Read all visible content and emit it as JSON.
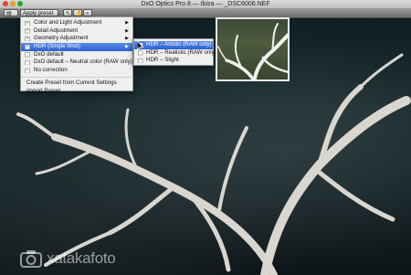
{
  "window": {
    "title": "DxO Optics Pro 8 — Ibiza — _DSC6006.NEF"
  },
  "toolbar": {
    "apply_preset_label": "Apply preset"
  },
  "menu": {
    "items": [
      {
        "label": "Color and Light Adjustment",
        "submenu": true
      },
      {
        "label": "Detail Adjustment",
        "submenu": true
      },
      {
        "label": "Geometry Adjustment",
        "submenu": true
      },
      {
        "label": "HDR (Single Shot)",
        "submenu": true,
        "highlighted": true
      },
      {
        "label": "DxO default",
        "submenu": false
      },
      {
        "label": "DxO default – Neutral color (RAW only)",
        "submenu": false
      },
      {
        "label": "No correction",
        "submenu": false
      }
    ],
    "actions": [
      {
        "label": "Create Preset from Current Settings"
      },
      {
        "label": "Import Preset..."
      }
    ]
  },
  "submenu": {
    "items": [
      {
        "label": "HDR – Artistic (RAW only)",
        "highlighted": true
      },
      {
        "label": "HDR – Realistic (RAW only)"
      },
      {
        "label": "HDR – Slight"
      }
    ]
  },
  "watermark": {
    "text": "xatakafoto"
  },
  "colors": {
    "highlight": "#2e62d4",
    "menu_bg": "#f6f6f6"
  },
  "icons": [
    "preset-icon",
    "chevron-right-icon",
    "cursor-icon",
    "camera-icon"
  ]
}
